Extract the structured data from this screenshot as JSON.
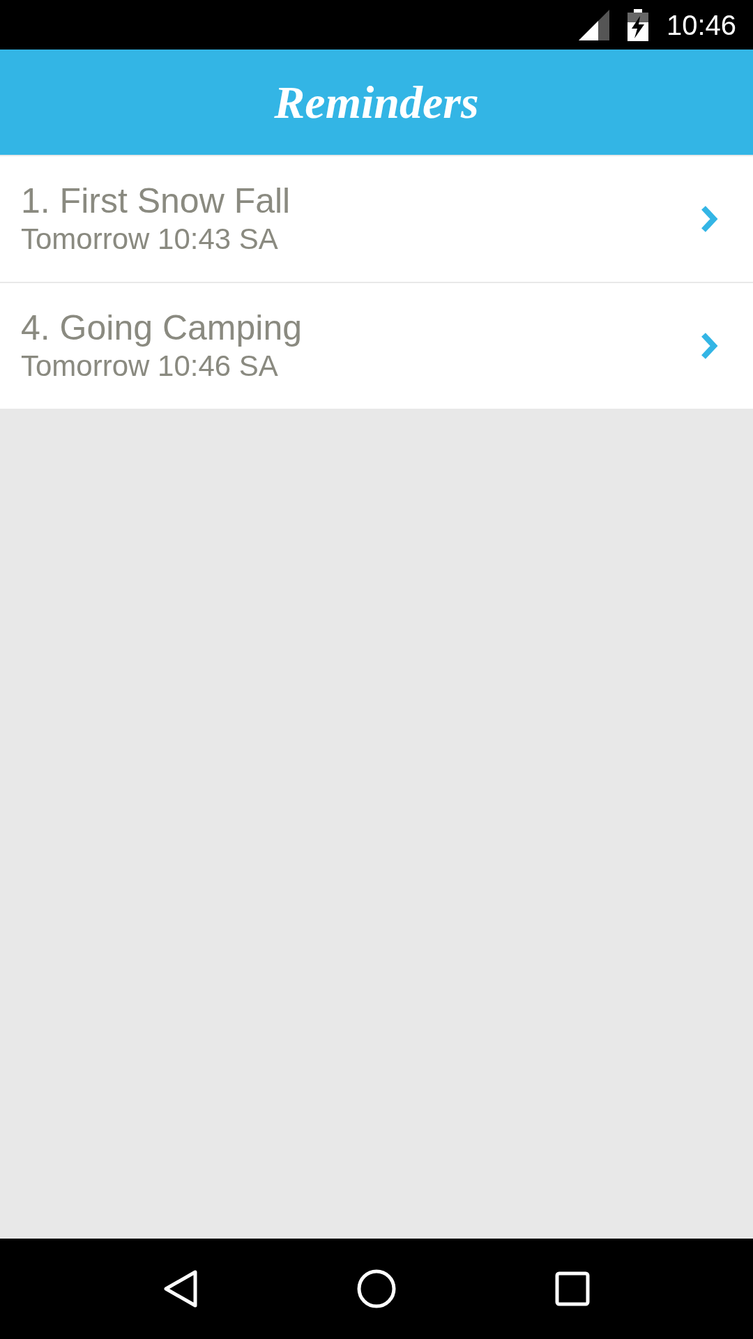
{
  "status_bar": {
    "time": "10:46"
  },
  "app_bar": {
    "title": "Reminders"
  },
  "reminders": [
    {
      "title": "1. First Snow Fall",
      "time": "Tomorrow 10:43 SA"
    },
    {
      "title": "4. Going Camping",
      "time": "Tomorrow 10:46 SA"
    }
  ]
}
